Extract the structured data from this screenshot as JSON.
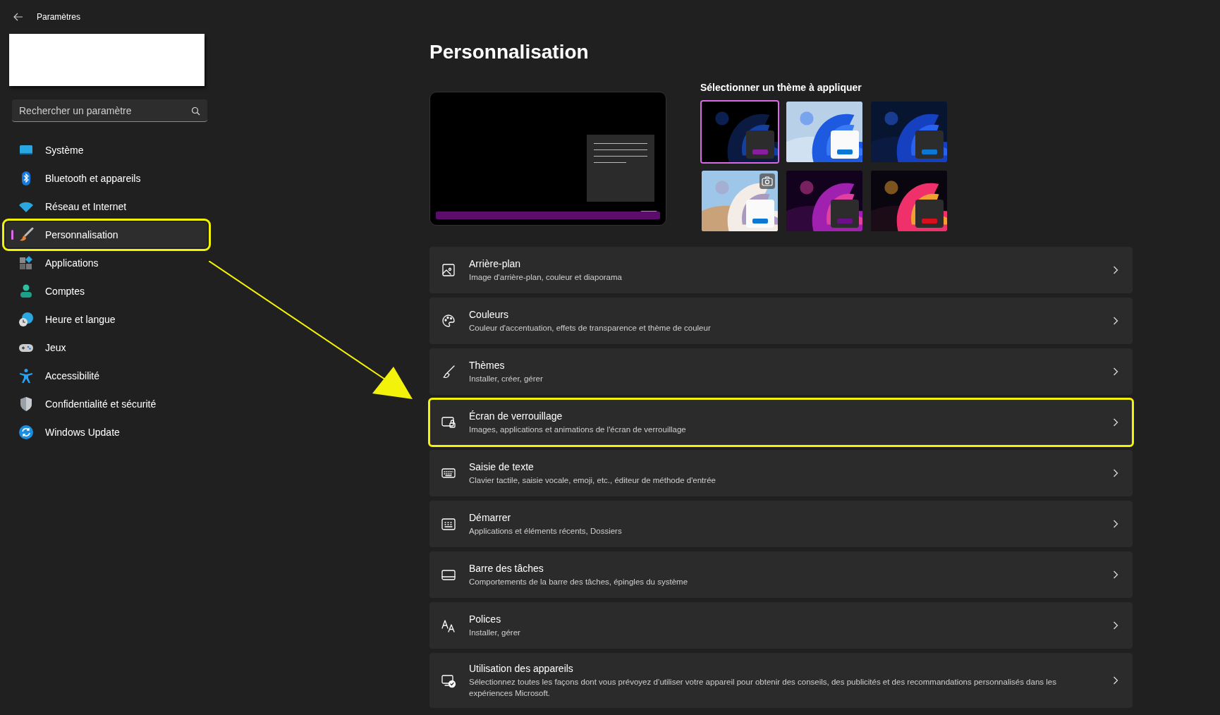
{
  "window": {
    "title": "Paramètres"
  },
  "search": {
    "placeholder": "Rechercher un paramètre"
  },
  "sidebar": {
    "items": [
      {
        "label": "Système",
        "selected": false,
        "highlighted": false
      },
      {
        "label": "Bluetooth et appareils",
        "selected": false,
        "highlighted": false
      },
      {
        "label": "Réseau et Internet",
        "selected": false,
        "highlighted": false
      },
      {
        "label": "Personnalisation",
        "selected": true,
        "highlighted": true
      },
      {
        "label": "Applications",
        "selected": false,
        "highlighted": false
      },
      {
        "label": "Comptes",
        "selected": false,
        "highlighted": false
      },
      {
        "label": "Heure et langue",
        "selected": false,
        "highlighted": false
      },
      {
        "label": "Jeux",
        "selected": false,
        "highlighted": false
      },
      {
        "label": "Accessibilité",
        "selected": false,
        "highlighted": false
      },
      {
        "label": "Confidentialité et sécurité",
        "selected": false,
        "highlighted": false
      },
      {
        "label": "Windows Update",
        "selected": false,
        "highlighted": false
      }
    ]
  },
  "page": {
    "title": "Personnalisation"
  },
  "themes": {
    "label": "Sélectionner un thème à appliquer",
    "items": [
      {
        "selected": true,
        "kind": "dark",
        "color": "#8a1ea0",
        "slideshow": false
      },
      {
        "selected": false,
        "kind": "light",
        "color": "#0a78d4",
        "slideshow": false
      },
      {
        "selected": false,
        "kind": "dark",
        "color": "#0a78d4",
        "slideshow": false
      },
      {
        "selected": false,
        "kind": "light",
        "color": "#0a78d4",
        "slideshow": true
      },
      {
        "selected": false,
        "kind": "dark",
        "color": "#6a0f8a",
        "slideshow": false
      },
      {
        "selected": false,
        "kind": "dark",
        "color": "#d8101c",
        "slideshow": false
      }
    ]
  },
  "settings": [
    {
      "title": "Arrière-plan",
      "subtitle": "Image d'arrière-plan, couleur et diaporama",
      "highlighted": false
    },
    {
      "title": "Couleurs",
      "subtitle": "Couleur d'accentuation, effets de transparence et thème de couleur",
      "highlighted": false
    },
    {
      "title": "Thèmes",
      "subtitle": "Installer, créer, gérer",
      "highlighted": false
    },
    {
      "title": "Écran de verrouillage",
      "subtitle": "Images, applications et animations de l'écran de verrouillage",
      "highlighted": true
    },
    {
      "title": "Saisie de texte",
      "subtitle": "Clavier tactile, saisie vocale, emoji, etc., éditeur de méthode d'entrée",
      "highlighted": false
    },
    {
      "title": "Démarrer",
      "subtitle": "Applications et éléments récents, Dossiers",
      "highlighted": false
    },
    {
      "title": "Barre des tâches",
      "subtitle": "Comportements de la barre des tâches, épingles du système",
      "highlighted": false
    },
    {
      "title": "Polices",
      "subtitle": "Installer, gérer",
      "highlighted": false
    },
    {
      "title": "Utilisation des appareils",
      "subtitle": "Sélectionnez toutes les façons dont vous prévoyez d’utiliser votre appareil pour obtenir des conseils, des publicités et des recommandations personnalisés dans les expériences Microsoft.",
      "highlighted": false
    }
  ]
}
